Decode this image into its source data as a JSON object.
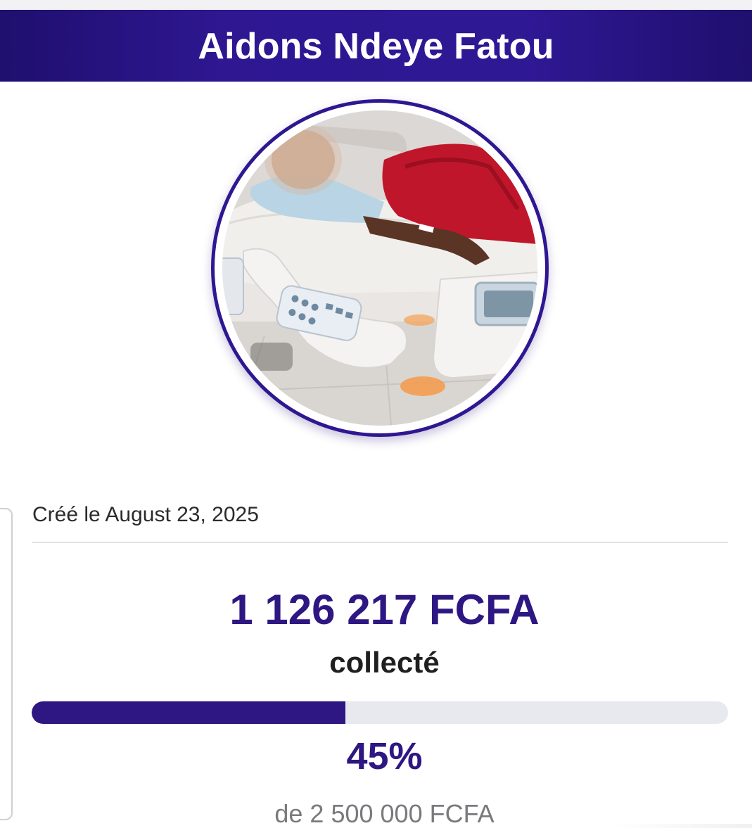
{
  "campaign": {
    "title": "Aidons Ndeye Fatou",
    "photo_icon": "campaign-photo",
    "created_text": "Créé le August 23, 2025",
    "amount_raised": "1 126 217 FCFA",
    "raised_label": "collecté",
    "progress_percent_value": 45,
    "progress_percent_text": "45%",
    "goal_text": "de 2 500 000 FCFA"
  },
  "colors": {
    "brand": "#2e1782",
    "header_bg": "#2e1791",
    "track": "#e7e9ee",
    "goal_text": "#7a7a7e"
  }
}
